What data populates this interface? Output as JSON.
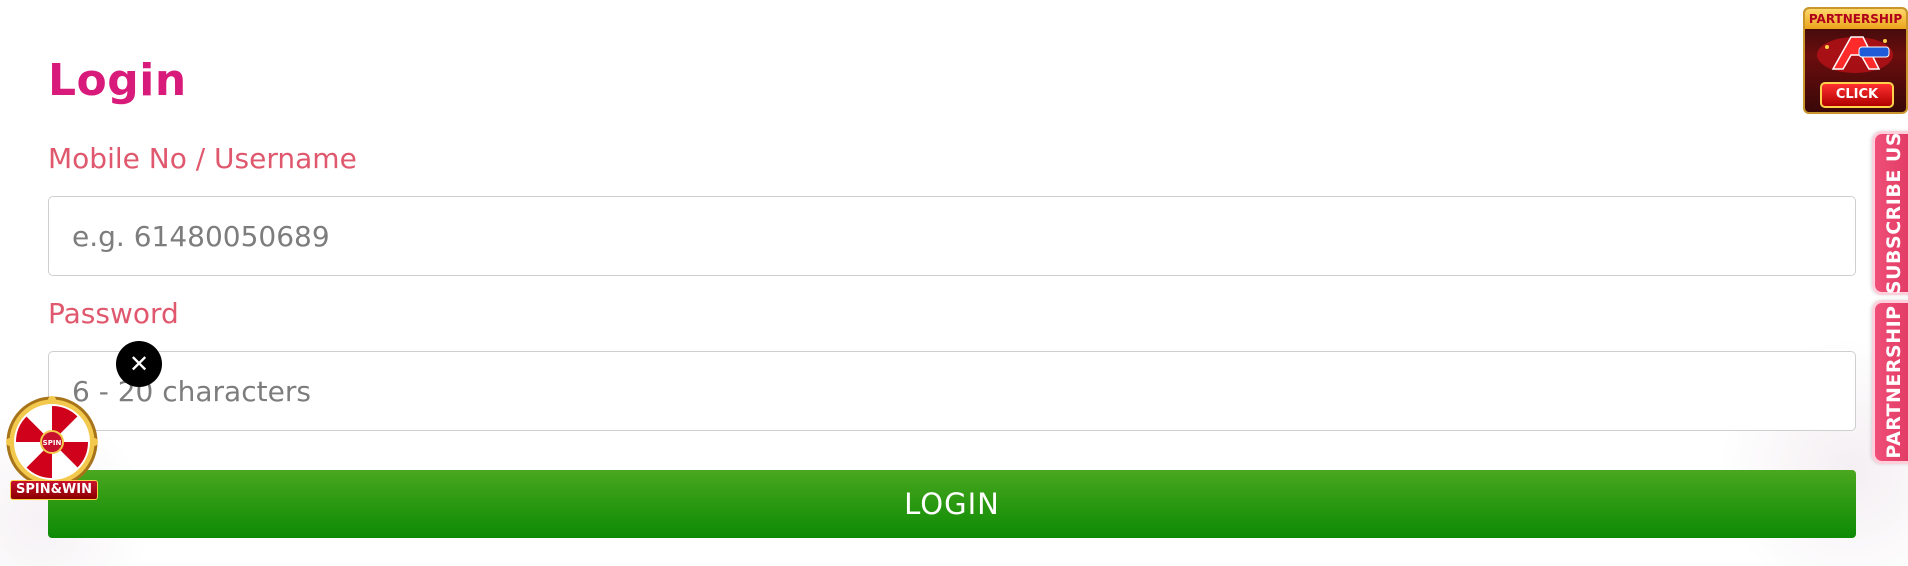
{
  "login": {
    "title": "Login",
    "username_label": "Mobile No / Username",
    "username_placeholder": "e.g. 61480050689",
    "password_label": "Password",
    "password_placeholder": "6 - 20 characters",
    "button_label": "LOGIN"
  },
  "overlay": {
    "close_symbol": "✕",
    "spin_label": "SPIN&WIN",
    "spin_center_text": "SPIN"
  },
  "partner_banner": {
    "title": "PARTNERSHIP",
    "click_label": "CLICK"
  },
  "side_tabs": {
    "subscribe_label": "SUBSCRIBE US",
    "partnership_label": "PARTNERSHIP"
  },
  "colors": {
    "title": "#d81b7a",
    "label": "#e0586d",
    "button_green": "#2d9a12",
    "side_tab": "#ef4f78"
  }
}
